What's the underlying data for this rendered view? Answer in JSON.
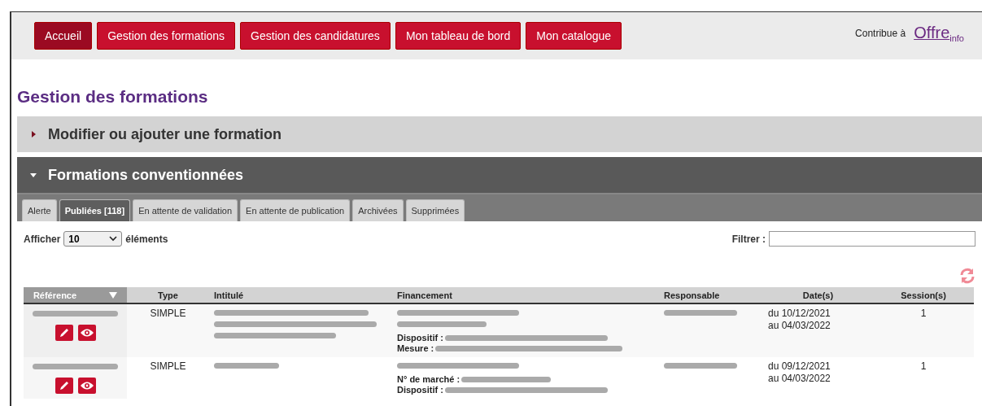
{
  "nav": {
    "buttons": [
      {
        "label": "Accueil",
        "selected": true
      },
      {
        "label": "Gestion des formations",
        "selected": false
      },
      {
        "label": "Gestion des candidatures",
        "selected": false
      },
      {
        "label": "Mon tableau de bord",
        "selected": false
      },
      {
        "label": "Mon catalogue",
        "selected": false
      }
    ],
    "contribute": {
      "text": "Contribue à",
      "logo_main": "Offre",
      "logo_sub": "info"
    }
  },
  "page_title": "Gestion des formations",
  "sections": [
    {
      "title": "Modifier ou ajouter une formation",
      "expanded": false
    },
    {
      "title": "Formations conventionnées",
      "expanded": true
    }
  ],
  "tabs": [
    {
      "label": "Alerte",
      "selected": false
    },
    {
      "label": "Publiées [118]",
      "selected": true
    },
    {
      "label": "En attente de validation",
      "selected": false
    },
    {
      "label": "En attente de publication",
      "selected": false
    },
    {
      "label": "Archivées",
      "selected": false
    },
    {
      "label": "Supprimées",
      "selected": false
    }
  ],
  "length": {
    "before": "Afficher",
    "value": "10",
    "after": "éléments"
  },
  "filter": {
    "label": "Filtrer :"
  },
  "table": {
    "columns": [
      {
        "label": "Référence",
        "sorted": true
      },
      {
        "label": "Type",
        "sorted": false
      },
      {
        "label": "Intitulé",
        "sorted": false
      },
      {
        "label": "Financement",
        "sorted": false
      },
      {
        "label": "Responsable",
        "sorted": false
      },
      {
        "label": "Date(s)",
        "sorted": false
      },
      {
        "label": "Session(s)",
        "sorted": false
      }
    ],
    "rows": [
      {
        "type": "SIMPLE",
        "intitule": [
          {
            "kind": "redacted"
          },
          {
            "kind": "redacted"
          },
          {
            "kind": "redacted"
          }
        ],
        "financement": [
          {
            "kind": "redacted"
          },
          {
            "kind": "redacted"
          },
          {
            "kind": "labeled",
            "label": "Dispositif :"
          },
          {
            "kind": "labeled",
            "label": "Mesure :"
          }
        ],
        "dates": [
          "du 10/12/2021",
          "au 04/03/2022"
        ],
        "sessions": "1"
      },
      {
        "type": "SIMPLE",
        "intitule": [
          {
            "kind": "redacted"
          }
        ],
        "financement": [
          {
            "kind": "redacted"
          },
          {
            "kind": "labeled",
            "label": "N° de marché :"
          },
          {
            "kind": "labeled",
            "label": "Dispositif :"
          }
        ],
        "dates": [
          "du 09/12/2021",
          "au 04/03/2022"
        ],
        "sessions": "1"
      }
    ]
  }
}
